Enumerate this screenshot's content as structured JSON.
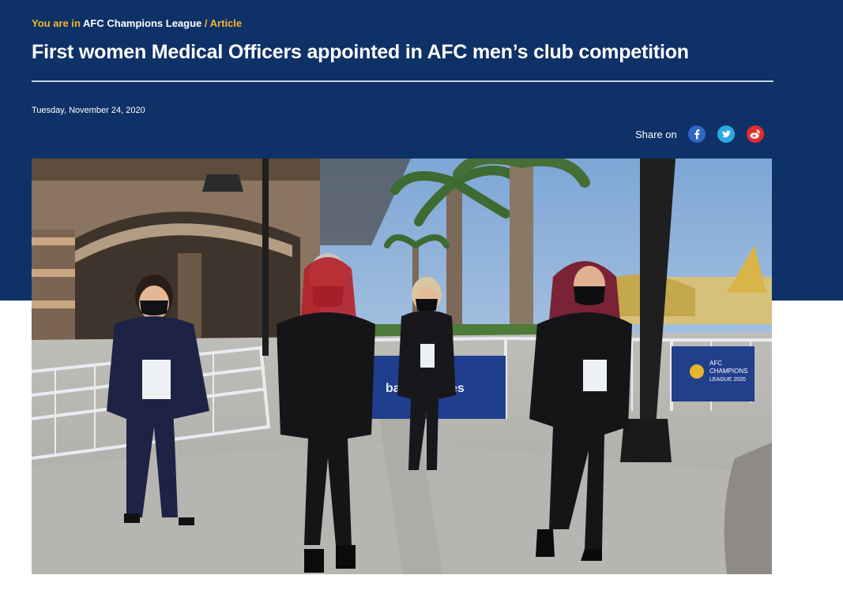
{
  "breadcrumb": {
    "prefix": "You are in",
    "section": "AFC Champions League",
    "separator": "/",
    "current": "Article"
  },
  "article": {
    "title": "First women Medical Officers appointed in AFC men’s club competition",
    "date": "Tuesday, November 24, 2020"
  },
  "share": {
    "label": "Share on",
    "icons": [
      "facebook-icon",
      "twitter-icon",
      "weibo-icon"
    ]
  },
  "photo": {
    "banner_text": "ballF",
    "banner_text_2": "es",
    "sign_line_1": "AFC",
    "sign_line_2": "CHAMPIONS",
    "sign_line_3": "LEAGUE 2020"
  },
  "colors": {
    "header_bg": "#0e3168",
    "breadcrumb_accent": "#f6b52a",
    "facebook": "#2f66c6",
    "twitter": "#2aa9e6",
    "weibo": "#e32c2c"
  }
}
